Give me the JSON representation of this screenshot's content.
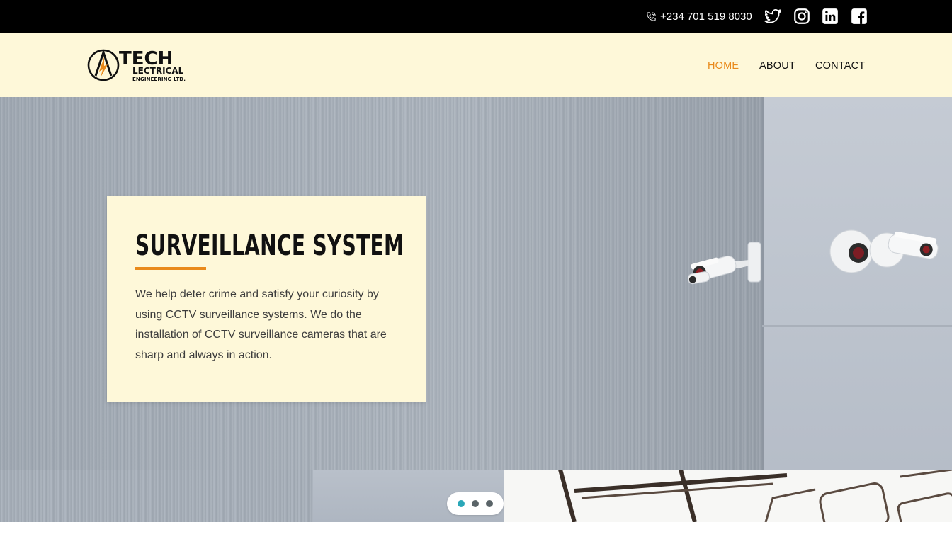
{
  "topbar": {
    "phone": "+234 701 519 8030",
    "phone_icon": "phone-icon",
    "social_icons": [
      "twitter-icon",
      "instagram-icon",
      "linkedin-icon",
      "facebook-icon"
    ]
  },
  "brand": {
    "logo_line1": "TECH",
    "logo_line2": "LECTRICAL",
    "logo_line3": "ENGINEERING LTD.",
    "accent_color": "#e98a1b"
  },
  "nav": {
    "home": "HOME",
    "about": "ABOUT",
    "contact": "CONTACT",
    "active": "HOME"
  },
  "hero": {
    "title": "SURVEILLANCE SYSTEM",
    "body": "We help deter crime and satisfy your curiosity by using CCTV surveillance systems. We do the installation of CCTV surveillance cameras that are sharp and always in action."
  },
  "carousel": {
    "slide_count": 3,
    "active_slide": 1
  },
  "colors": {
    "topbar_bg": "#000000",
    "header_bg": "#fef8d9",
    "active_dot": "#2aa7b8"
  }
}
